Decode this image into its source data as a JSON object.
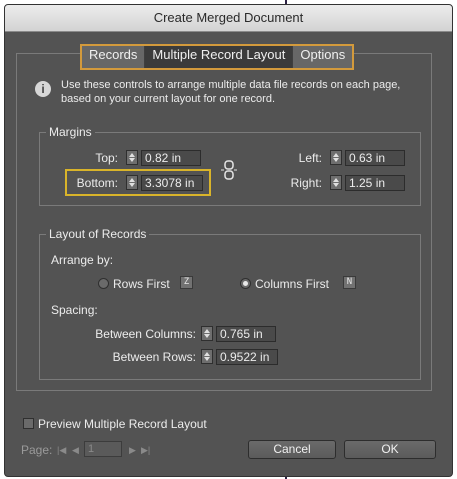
{
  "window": {
    "title": "Create Merged Document"
  },
  "tabs": [
    {
      "label": "Records",
      "active": false
    },
    {
      "label": "Multiple Record Layout",
      "active": true
    },
    {
      "label": "Options",
      "active": false
    }
  ],
  "info": {
    "icon": "info-icon",
    "text": "Use these controls to arrange multiple data file records on each page, based on your current layout for one record."
  },
  "margins": {
    "legend": "Margins",
    "top": {
      "label": "Top:",
      "value": "0.82 in"
    },
    "bottom": {
      "label": "Bottom:",
      "value": "3.3078 in"
    },
    "left": {
      "label": "Left:",
      "value": "0.63 in"
    },
    "right": {
      "label": "Right:",
      "value": "1.25 in"
    },
    "link_icon": "chain-link-icon"
  },
  "layout": {
    "legend": "Layout of Records",
    "arrange_by": "Arrange by:",
    "rows_first": {
      "label": "Rows First",
      "selected": false,
      "icon": "rows-first-icon"
    },
    "columns_first": {
      "label": "Columns First",
      "selected": true,
      "icon": "columns-first-icon"
    },
    "spacing": "Spacing:",
    "between_columns": {
      "label": "Between Columns:",
      "value": "0.765 in"
    },
    "between_rows": {
      "label": "Between Rows:",
      "value": "0.9522 in"
    }
  },
  "preview": {
    "label": "Preview Multiple Record Layout",
    "checked": false
  },
  "page_nav": {
    "label": "Page:",
    "value": "1"
  },
  "buttons": {
    "cancel": "Cancel",
    "ok": "OK"
  },
  "colors": {
    "dialog_bg": "#535353",
    "tab_highlight": "#d39a3c",
    "field_highlight": "#d9b42a"
  }
}
